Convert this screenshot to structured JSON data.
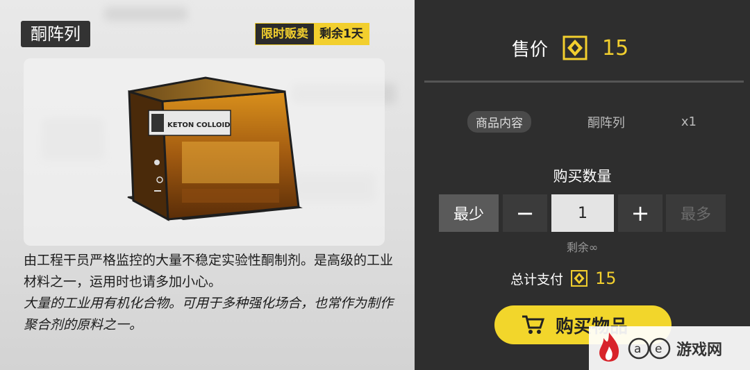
{
  "item": {
    "name": "酮阵列",
    "limited_label": "限时贩卖",
    "remaining_label": "剩余1天",
    "box_label": "KETON COLLOID",
    "description": "由工程干员严格监控的大量不稳定实验性酮制剂。是高级的工业材料之一，运用时也请多加小心。",
    "flavor": "大量的工业用有机化合物。可用于多种强化场合，也常作为制作聚合剂的原料之一。"
  },
  "purchase": {
    "price_label": "售价",
    "price": "15",
    "content_pill": "商品内容",
    "content_name": "酮阵列",
    "content_qty": "x1",
    "qty_label": "购买数量",
    "min_label": "最少",
    "minus": "−",
    "quantity": "1",
    "plus": "+",
    "max_label": "最多",
    "stock": "剩余∞",
    "total_label": "总计支付",
    "total": "15",
    "buy_label": "购买物品"
  },
  "watermark": {
    "text": "游戏网"
  },
  "colors": {
    "accent": "#f2d62b",
    "panel": "#2e2e2e"
  }
}
